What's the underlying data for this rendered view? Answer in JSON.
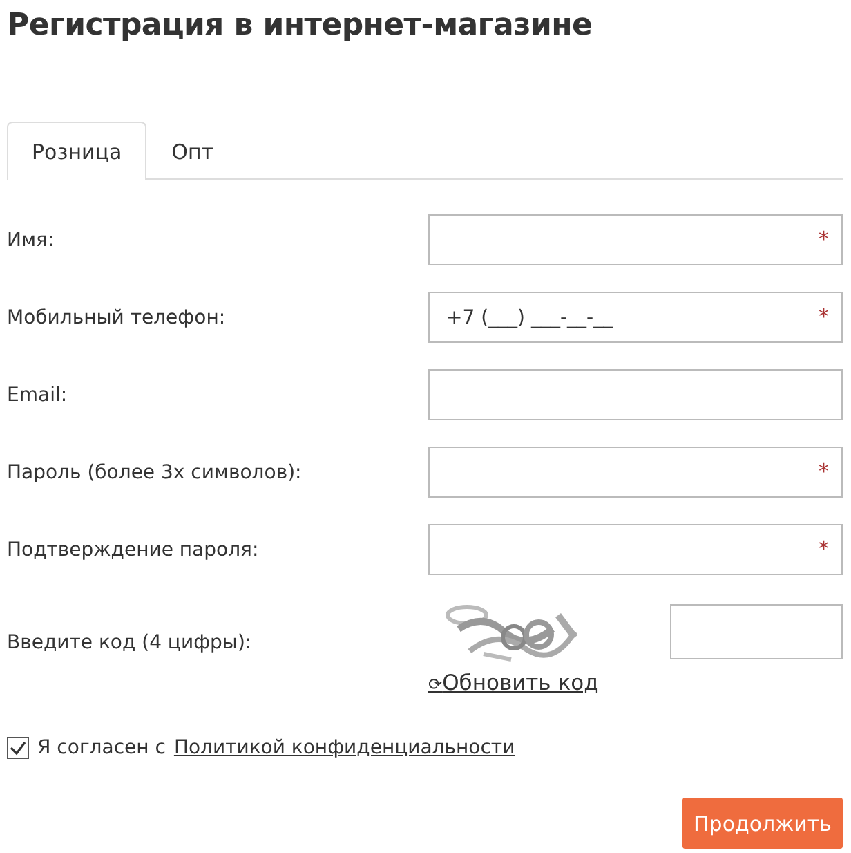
{
  "title": "Регистрация в интернет-магазине",
  "tabs": [
    {
      "label": "Розница",
      "selected": true
    },
    {
      "label": "Опт",
      "selected": false
    }
  ],
  "fields": [
    {
      "label": "Имя:",
      "required": true
    },
    {
      "label": "Мобильный телефон:",
      "required": true,
      "placeholder": "+7 (___) ___-__-__"
    },
    {
      "label": "Email:",
      "required": false
    },
    {
      "label": "Пароль (более 3х символов):",
      "required": true
    },
    {
      "label": "Подтверждение пароля:",
      "required": true
    }
  ],
  "required_mark": "*",
  "captcha": {
    "label": "Введите код (4 цифры):",
    "refresh_icon": "⟳",
    "refresh": "Обновить код"
  },
  "agreement": {
    "checked": true,
    "text": "Я согласен с",
    "link": "Политикой конфиденциальности"
  },
  "submit": "Продолжить"
}
